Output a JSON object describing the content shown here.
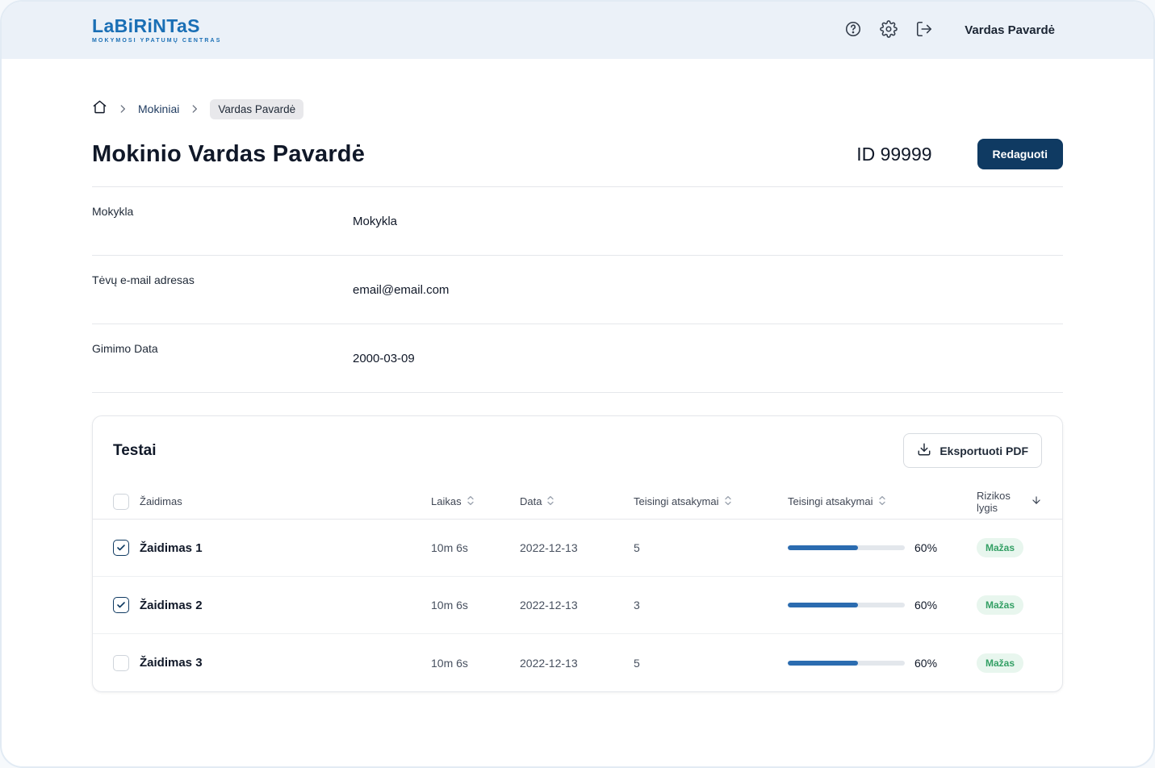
{
  "colors": {
    "header_bg": "#EBF1F8",
    "brand_blue": "#1A6FB5",
    "primary_navy": "#0F3A62",
    "progress_blue": "#2B6CB0",
    "badge_green_bg": "#E8F6EE",
    "badge_green_text": "#34A065",
    "border": "#E5E7EB"
  },
  "header": {
    "logo_text": "LaBiRiNTaS",
    "logo_subtitle": "MOKYMOSI YPATUMŲ CENTRAS",
    "icons": [
      "help-icon",
      "settings-icon",
      "logout-icon"
    ],
    "user_name": "Vardas Pavardė"
  },
  "breadcrumb": {
    "home_icon": "home-icon",
    "items": [
      {
        "label": "Mokiniai",
        "active": false
      },
      {
        "label": "Vardas Pavardė",
        "active": true
      }
    ]
  },
  "student": {
    "title": "Mokinio Vardas Pavardė",
    "id_text": "ID 99999",
    "edit_button_label": "Redaguoti",
    "details": [
      {
        "label": "Mokykla",
        "value": "Mokykla"
      },
      {
        "label": "Tėvų e-mail adresas",
        "value": "email@email.com"
      },
      {
        "label": "Gimimo Data",
        "value": "2000-03-09"
      }
    ]
  },
  "tests": {
    "title": "Testai",
    "export_button_label": "Eksportuoti PDF",
    "columns": {
      "game": "Žaidimas",
      "time": "Laikas",
      "date": "Data",
      "correct": "Teisingi atsakymai",
      "correct2": "Teisingi atsakymai",
      "risk": "Rizikos lygis"
    },
    "rows": [
      {
        "checked": true,
        "name": "Žaidimas 1",
        "time": "10m 6s",
        "date": "2022-12-13",
        "correct": "5",
        "progress_pct": 60,
        "progress_label": "60%",
        "risk": "Mažas"
      },
      {
        "checked": true,
        "name": "Žaidimas 2",
        "time": "10m 6s",
        "date": "2022-12-13",
        "correct": "3",
        "progress_pct": 60,
        "progress_label": "60%",
        "risk": "Mažas"
      },
      {
        "checked": false,
        "name": "Žaidimas 3",
        "time": "10m 6s",
        "date": "2022-12-13",
        "correct": "5",
        "progress_pct": 60,
        "progress_label": "60%",
        "risk": "Mažas"
      }
    ]
  }
}
